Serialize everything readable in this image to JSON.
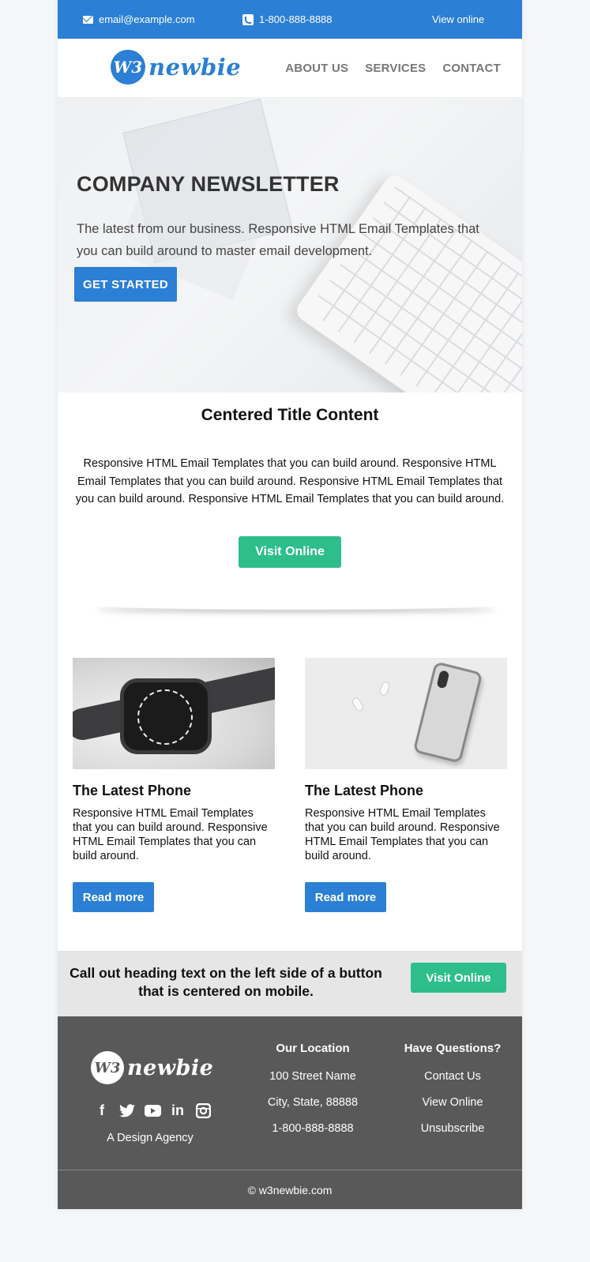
{
  "topbar": {
    "email": "email@example.com",
    "phone": "1-800-888-8888",
    "view_online": "View online"
  },
  "header": {
    "logo_badge": "W3",
    "logo_text": "newbie",
    "nav": [
      "ABOUT US",
      "SERVICES",
      "CONTACT"
    ]
  },
  "hero": {
    "title": "COMPANY NEWSLETTER",
    "text": "The latest from our business. Responsive HTML Email Templates that you can build around to master email development.",
    "button": "GET STARTED"
  },
  "center": {
    "title": "Centered Title Content",
    "text": "Responsive HTML Email Templates that you can build around. Responsive HTML Email Templates that you can build around. Responsive HTML Email Templates that you can build around. Responsive HTML Email Templates that you can build around.",
    "button": "Visit Online"
  },
  "cards": [
    {
      "title": "The Latest Phone",
      "text": "Responsive HTML Email Templates that you can build around. Responsive HTML Email Templates that you can build around.",
      "button": "Read more"
    },
    {
      "title": "The Latest Phone",
      "text": "Responsive HTML Email Templates that you can build around. Responsive HTML Email Templates that you can build around.",
      "button": "Read more"
    }
  ],
  "callout": {
    "text": "Call out heading text on the left side of a button that is centered on mobile.",
    "button": "Visit Online"
  },
  "footer": {
    "logo_badge": "W3",
    "logo_text": "newbie",
    "social_icons": [
      "facebook-icon",
      "twitter-icon",
      "youtube-icon",
      "linkedin-icon",
      "instagram-icon"
    ],
    "tagline": "A Design Agency",
    "location": {
      "heading": "Our Location",
      "lines": [
        "100 Street Name",
        "City, State, 88888",
        "1-800-888-8888"
      ]
    },
    "questions": {
      "heading": "Have Questions?",
      "links": [
        "Contact Us",
        "View Online",
        "Unsubscribe"
      ]
    },
    "copyright": "© w3newbie.com"
  },
  "colors": {
    "brand_blue": "#2b7fd4",
    "accent_green": "#2dbe8b",
    "footer_gray": "#595959",
    "callout_gray": "#e6e6e6"
  }
}
